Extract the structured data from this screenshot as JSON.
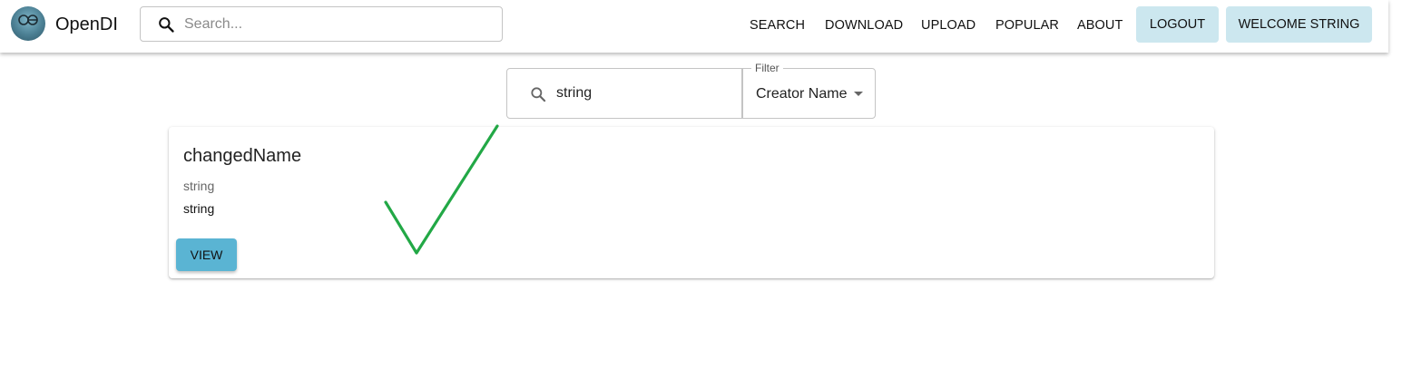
{
  "app": {
    "brand": "OpenDI",
    "logo_text": "OPEN DI"
  },
  "header": {
    "search_placeholder": "Search...",
    "search_value": "",
    "nav": [
      "SEARCH",
      "DOWNLOAD",
      "UPLOAD",
      "POPULAR",
      "ABOUT"
    ],
    "logout_label": "LOGOUT",
    "welcome_label": "WELCOME STRING"
  },
  "filter": {
    "query_value": "string",
    "select_label": "Filter",
    "select_value": "Creator Name"
  },
  "results": [
    {
      "title": "changedName",
      "subtitle": "string",
      "body": "string",
      "button_label": "VIEW"
    }
  ],
  "icons": {
    "search": "search-icon",
    "dropdown": "caret-down-icon",
    "annotation": "checkmark-icon"
  },
  "colors": {
    "button_bg": "#cce7ef",
    "view_button_bg": "#5ab4d3",
    "checkmark": "#22a846"
  }
}
